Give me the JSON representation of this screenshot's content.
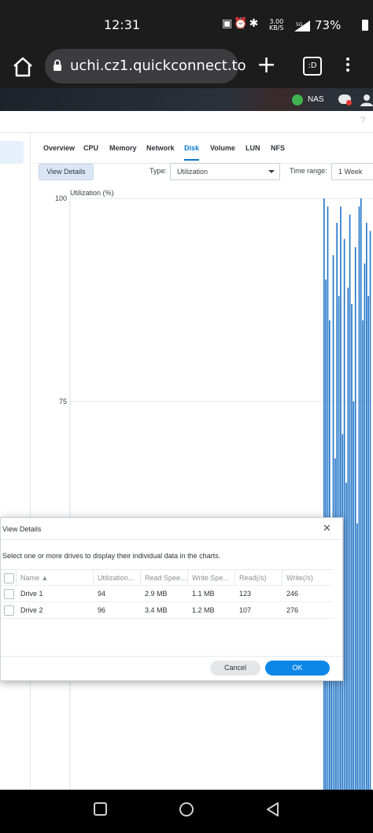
{
  "status_bar": {
    "time": "12:31",
    "net_speed_value": "3.00",
    "net_speed_unit": "KB/S",
    "network": "5G",
    "battery": "73%"
  },
  "browser": {
    "url": "uchi.cz1.quickconnect.to",
    "tab_count": ":D"
  },
  "dsm_bar": {
    "nas_label": "NAS"
  },
  "help": "?",
  "tabs": [
    "Overview",
    "CPU",
    "Memory",
    "Network",
    "Disk",
    "Volume",
    "LUN",
    "NFS"
  ],
  "active_tab": "Disk",
  "toolbar": {
    "view_details_label": "View Details",
    "type_label": "Type:",
    "type_value": "Utilization",
    "time_range_label": "Time range:",
    "time_range_value": "1 Week"
  },
  "chart_data": {
    "type": "bar",
    "ylabel": "Utilization (%)",
    "yticks": [
      75,
      100
    ],
    "ylim": [
      50,
      100
    ],
    "grid": true,
    "series": [
      {
        "values": [
          100,
          90,
          99,
          85,
          58,
          93,
          68,
          97,
          88,
          99,
          71,
          95,
          65,
          89,
          98,
          87,
          75,
          94,
          60,
          99,
          100,
          85,
          92,
          97,
          88,
          96
        ]
      }
    ]
  },
  "dialog": {
    "title": "View Details",
    "description": "Select one or more drives to display their individual data in the charts.",
    "columns": [
      "Name",
      "Utilization...",
      "Read Spee...",
      "Write Spe...",
      "Read(/s)",
      "Write(/s)"
    ],
    "rows": [
      {
        "name": "Drive 1",
        "utilization": "94",
        "read_speed": "2.9 MB",
        "write_speed": "1.1 MB",
        "reads": "123",
        "writes": "246"
      },
      {
        "name": "Drive 2",
        "utilization": "96",
        "read_speed": "3.4 MB",
        "write_speed": "1.2 MB",
        "reads": "107",
        "writes": "276"
      }
    ],
    "cancel_label": "Cancel",
    "ok_label": "OK"
  },
  "colors": {
    "accent": "#0e7acb",
    "bar": "#1f73c8",
    "ok_button": "#0c87e8",
    "nas_status": "#3fb34f"
  }
}
